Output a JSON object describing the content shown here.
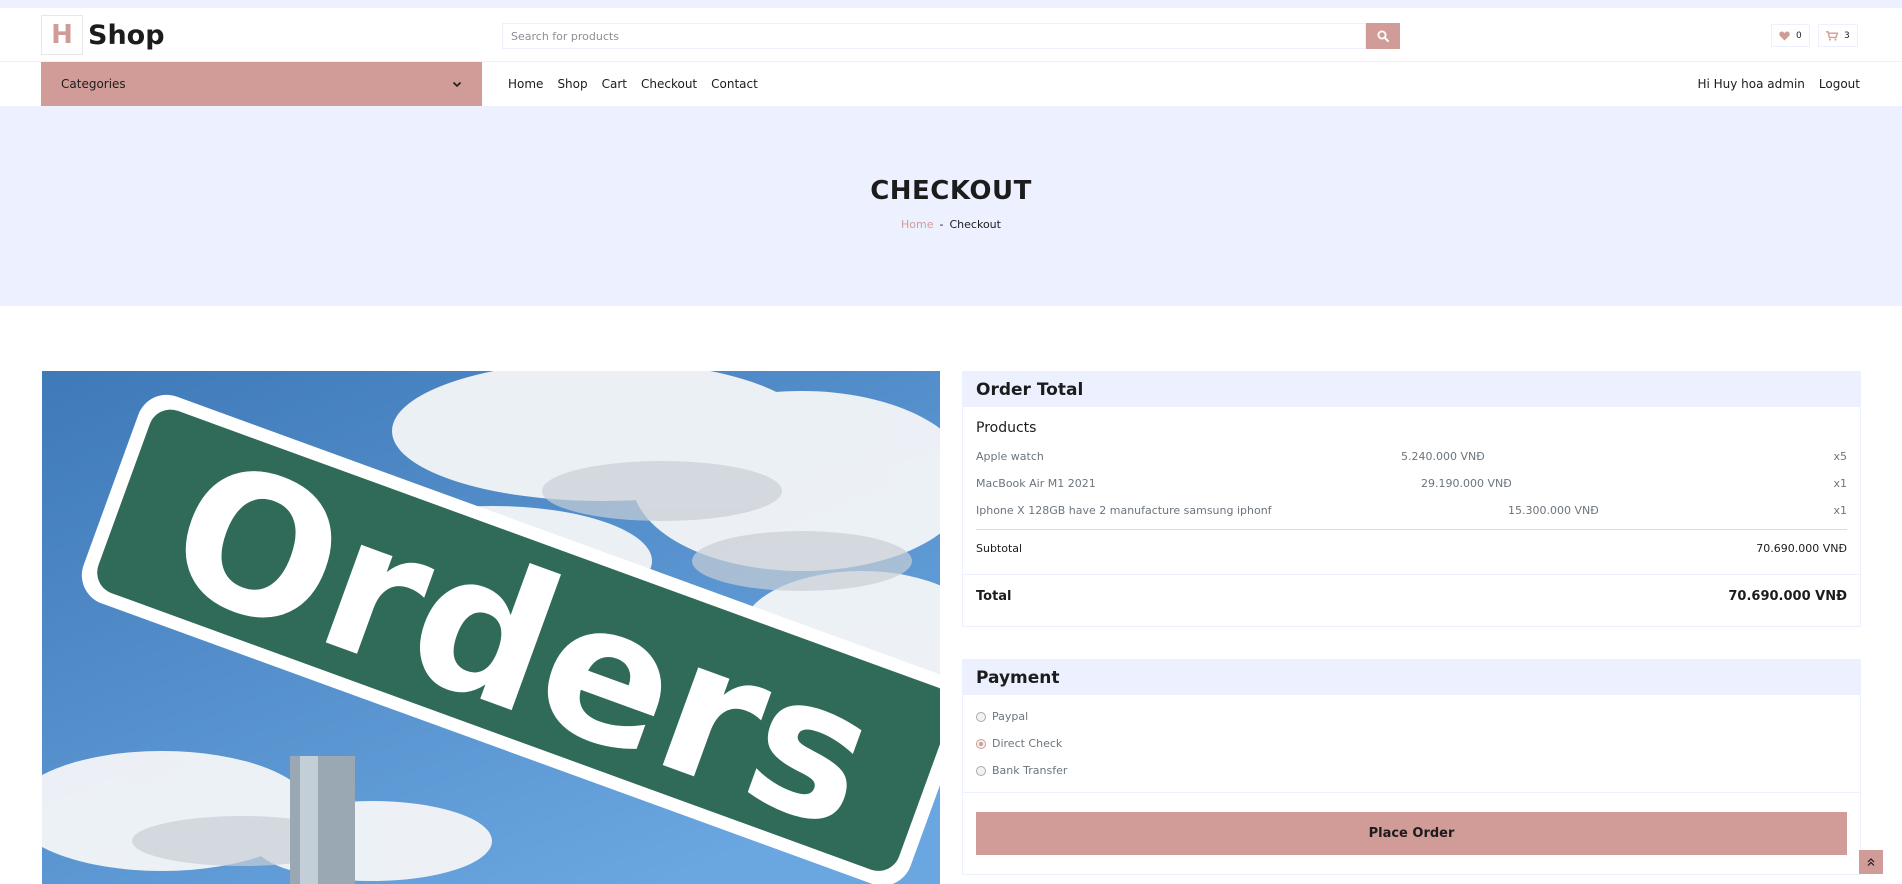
{
  "header": {
    "logo_letter": "H",
    "logo_text": "Shop",
    "search_placeholder": "Search for products",
    "wishlist_count": "0",
    "cart_count": "3"
  },
  "nav": {
    "categories_label": "Categories",
    "links": [
      "Home",
      "Shop",
      "Cart",
      "Checkout",
      "Contact"
    ],
    "greeting": "Hi Huy hoa admin",
    "logout": "Logout"
  },
  "banner": {
    "title": "CHECKOUT",
    "crumb_home": "Home",
    "crumb_sep": "-",
    "crumb_current": "Checkout"
  },
  "image": {
    "sign_text": "Orders"
  },
  "order_total": {
    "heading": "Order Total",
    "products_heading": "Products",
    "items": [
      {
        "name": "Apple watch",
        "price": "5.240.000 VNĐ",
        "qty": "x5"
      },
      {
        "name": "MacBook Air M1 2021",
        "price": "29.190.000 VNĐ",
        "qty": "x1"
      },
      {
        "name": "Iphone X 128GB have 2 manufacture samsung iphonf",
        "price": "15.300.000 VNĐ",
        "qty": "x1"
      }
    ],
    "subtotal_label": "Subtotal",
    "subtotal_value": "70.690.000 VNĐ",
    "total_label": "Total",
    "total_value": "70.690.000 VNĐ"
  },
  "payment": {
    "heading": "Payment",
    "options": [
      {
        "label": "Paypal",
        "selected": false
      },
      {
        "label": "Direct Check",
        "selected": true
      },
      {
        "label": "Bank Transfer",
        "selected": false
      }
    ],
    "place_order": "Place Order"
  },
  "colors": {
    "accent": "#d19c97",
    "light": "#edf1ff",
    "dark": "#1c1c1c"
  }
}
